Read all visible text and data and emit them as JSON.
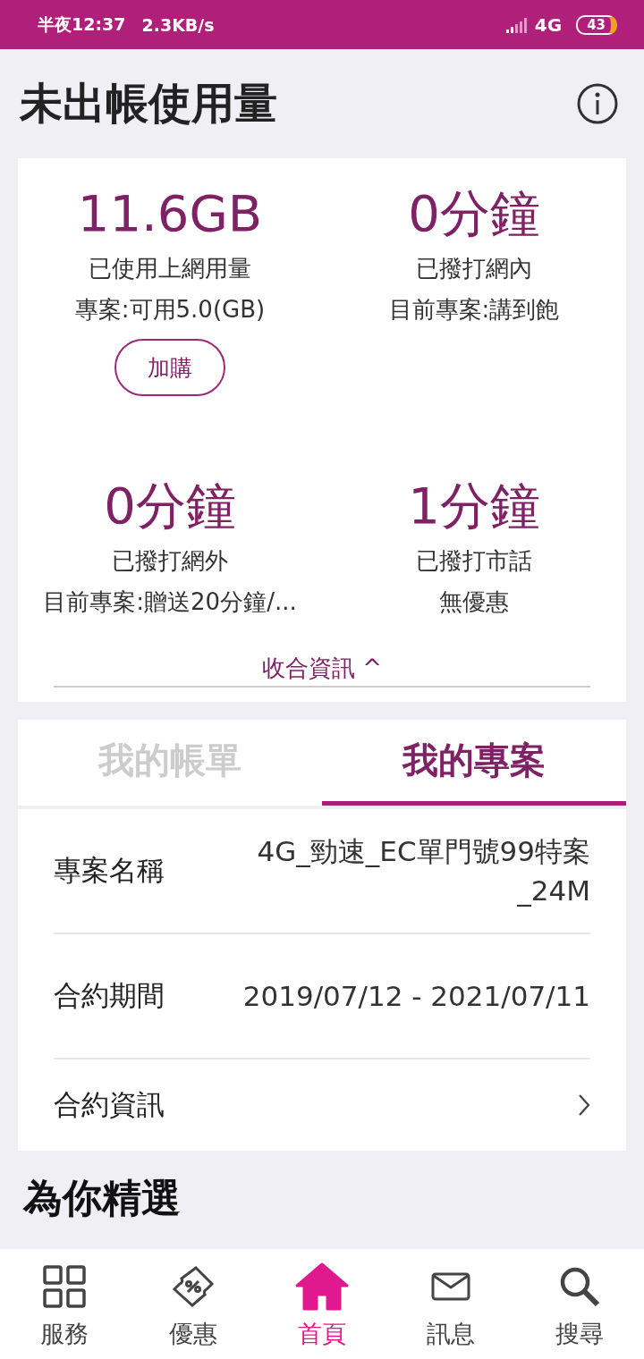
{
  "status_bar": {
    "time": "半夜12:37",
    "speed": "2.3KB/s",
    "network": "4G",
    "battery": "43"
  },
  "header": {
    "title": "未出帳使用量"
  },
  "usage": [
    {
      "amount": "11.6GB",
      "label": "已使用上網用量",
      "plan": "專案:可用5.0(GB)",
      "button": "加購"
    },
    {
      "amount": "0分鐘",
      "label": "已撥打網內",
      "plan": "目前專案:講到飽"
    },
    {
      "amount": "0分鐘",
      "label": "已撥打網外",
      "plan": "目前專案:贈送20分鐘/..."
    },
    {
      "amount": "1分鐘",
      "label": "已撥打市話",
      "plan": "無優惠"
    }
  ],
  "collapse_link": "收合資訊 ^",
  "tabs": [
    {
      "label": "我的帳單",
      "selected": false
    },
    {
      "label": "我的專案",
      "selected": true
    }
  ],
  "plan_rows": [
    {
      "kind": "value",
      "label": "專案名稱",
      "value": "4G_勁速_EC單門號99特案_24M"
    },
    {
      "kind": "value",
      "label": "合約期間",
      "value": "2019/07/12 - 2021/07/11"
    },
    {
      "kind": "link",
      "label": "合約資訊"
    }
  ],
  "section_heading": "為你精選",
  "bottom_nav": [
    {
      "label": "服務",
      "kind": "grid",
      "selected": false
    },
    {
      "label": "優惠",
      "kind": "coupon",
      "selected": false
    },
    {
      "label": "首頁",
      "kind": "home",
      "selected": true
    },
    {
      "label": "訊息",
      "kind": "mail",
      "selected": false
    },
    {
      "label": "搜尋",
      "kind": "search",
      "selected": false
    }
  ]
}
